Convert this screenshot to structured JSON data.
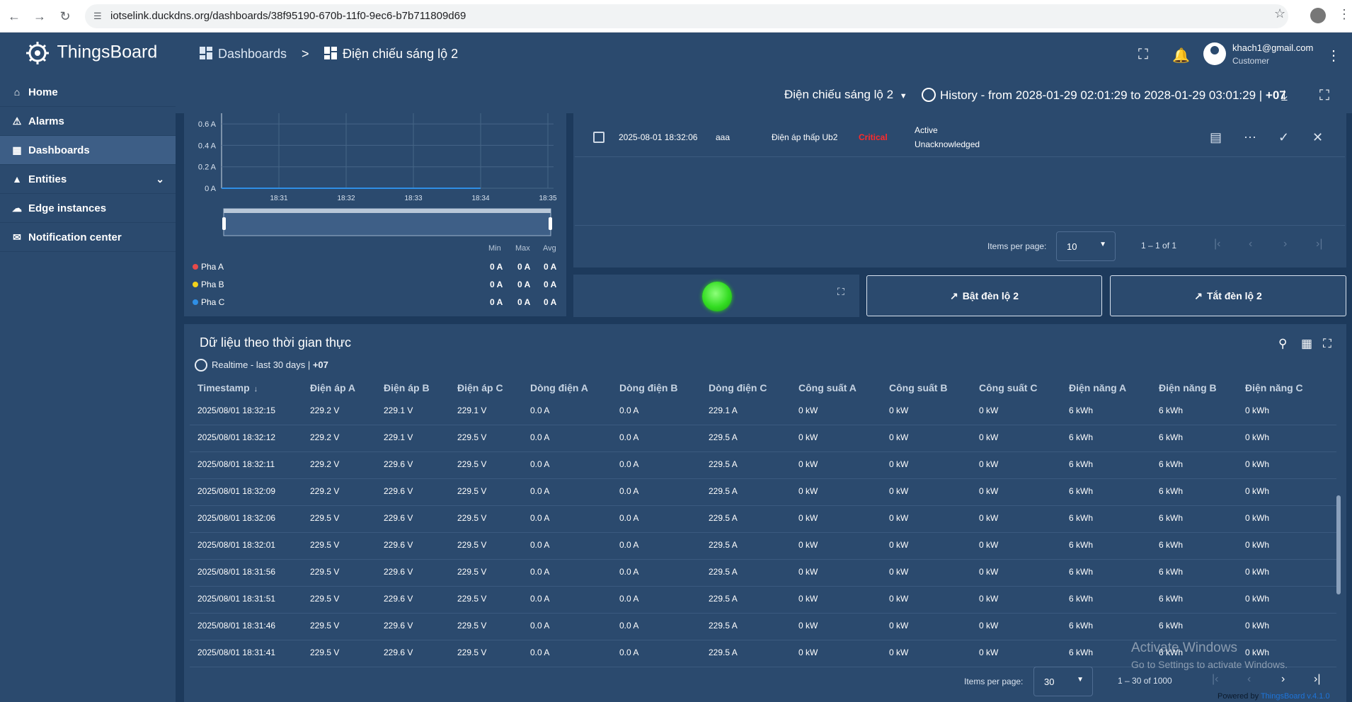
{
  "browser": {
    "url": "iotselink.duckdns.org/dashboards/38f95190-670b-11f0-9ec6-b7b711809d69",
    "back_icon": "arrow-left-icon",
    "forward_icon": "arrow-right-icon",
    "reload_icon": "reload-icon"
  },
  "app": {
    "name": "ThingsBoard"
  },
  "breadcrumb": {
    "root": "Dashboards",
    "separator": ">",
    "current": "Điện chiếu sáng lộ 2"
  },
  "user": {
    "email": "khach1@gmail.com",
    "role": "Customer"
  },
  "toolbar": {
    "state_selector": "Điện chiếu sáng lộ 2",
    "history_label": "History - from 2028-01-29 02:01:29 to 2028-01-29 03:01:29 | ",
    "history_tz": "+07"
  },
  "sidebar": {
    "items": [
      {
        "label": "Home",
        "icon": "home-icon"
      },
      {
        "label": "Alarms",
        "icon": "warning-icon"
      },
      {
        "label": "Dashboards",
        "icon": "dashboard-icon",
        "active": true
      },
      {
        "label": "Entities",
        "icon": "entities-icon",
        "expandable": true
      },
      {
        "label": "Edge instances",
        "icon": "edge-icon"
      },
      {
        "label": "Notification center",
        "icon": "notification-icon"
      }
    ]
  },
  "chart_data": {
    "type": "line",
    "title": "",
    "xlabel": "",
    "ylabel": "",
    "y_ticks": [
      "0.6 A",
      "0.4 A",
      "0.2 A",
      "0 A"
    ],
    "ylim": [
      0,
      0.7
    ],
    "x_ticks": [
      "18:31",
      "18:32",
      "18:33",
      "18:34",
      "18:35"
    ],
    "series": [
      {
        "name": "Pha A",
        "color": "#e84a4a",
        "values": [
          0,
          0,
          0,
          0,
          0
        ]
      },
      {
        "name": "Pha B",
        "color": "#f2d21b",
        "values": [
          0,
          0,
          0,
          0,
          0
        ]
      },
      {
        "name": "Pha C",
        "color": "#2f8fe6",
        "values": [
          0,
          0,
          0,
          0,
          0
        ]
      }
    ],
    "legend_headers": [
      "Min",
      "Max",
      "Avg"
    ],
    "legend_values": [
      [
        "0 A",
        "0 A",
        "0 A"
      ],
      [
        "0 A",
        "0 A",
        "0 A"
      ],
      [
        "0 A",
        "0 A",
        "0 A"
      ]
    ]
  },
  "alarm": {
    "time": "2025-08-01 18:32:06",
    "originator": "aaa",
    "type": "Điện áp thấp Ub2",
    "severity": "Critical",
    "status_line1": "Active",
    "status_line2": "Unacknowledged",
    "pager": {
      "items_label": "Items per page:",
      "items_value": "10",
      "range": "1 – 1 of 1"
    }
  },
  "controls": {
    "on_button": "Bật đèn lộ 2",
    "off_button": "Tắt đèn lộ 2",
    "indicator_color": "#33dd22"
  },
  "table": {
    "title": "Dữ liệu theo thời gian thực",
    "subtitle": "Realtime - last 30 days | ",
    "subtitle_tz": "+07",
    "columns": [
      "Timestamp",
      "Điện áp A",
      "Điện áp B",
      "Điện áp C",
      "Dòng điện A",
      "Dòng điện B",
      "Dòng điện C",
      "Công suất A",
      "Công suất B",
      "Công suất C",
      "Điện năng A",
      "Điện năng B",
      "Điện năng C"
    ],
    "sort_icon": "arrow-down-icon",
    "rows": [
      [
        "2025/08/01 18:32:15",
        "229.2 V",
        "229.1 V",
        "229.1 V",
        "0.0 A",
        "0.0 A",
        "229.1 A",
        "0 kW",
        "0 kW",
        "0 kW",
        "6 kWh",
        "6 kWh",
        "0 kWh"
      ],
      [
        "2025/08/01 18:32:12",
        "229.2 V",
        "229.1 V",
        "229.5 V",
        "0.0 A",
        "0.0 A",
        "229.5 A",
        "0 kW",
        "0 kW",
        "0 kW",
        "6 kWh",
        "6 kWh",
        "0 kWh"
      ],
      [
        "2025/08/01 18:32:11",
        "229.2 V",
        "229.6 V",
        "229.5 V",
        "0.0 A",
        "0.0 A",
        "229.5 A",
        "0 kW",
        "0 kW",
        "0 kW",
        "6 kWh",
        "6 kWh",
        "0 kWh"
      ],
      [
        "2025/08/01 18:32:09",
        "229.2 V",
        "229.6 V",
        "229.5 V",
        "0.0 A",
        "0.0 A",
        "229.5 A",
        "0 kW",
        "0 kW",
        "0 kW",
        "6 kWh",
        "6 kWh",
        "0 kWh"
      ],
      [
        "2025/08/01 18:32:06",
        "229.5 V",
        "229.6 V",
        "229.5 V",
        "0.0 A",
        "0.0 A",
        "229.5 A",
        "0 kW",
        "0 kW",
        "0 kW",
        "6 kWh",
        "6 kWh",
        "0 kWh"
      ],
      [
        "2025/08/01 18:32:01",
        "229.5 V",
        "229.6 V",
        "229.5 V",
        "0.0 A",
        "0.0 A",
        "229.5 A",
        "0 kW",
        "0 kW",
        "0 kW",
        "6 kWh",
        "6 kWh",
        "0 kWh"
      ],
      [
        "2025/08/01 18:31:56",
        "229.5 V",
        "229.6 V",
        "229.5 V",
        "0.0 A",
        "0.0 A",
        "229.5 A",
        "0 kW",
        "0 kW",
        "0 kW",
        "6 kWh",
        "6 kWh",
        "0 kWh"
      ],
      [
        "2025/08/01 18:31:51",
        "229.5 V",
        "229.6 V",
        "229.5 V",
        "0.0 A",
        "0.0 A",
        "229.5 A",
        "0 kW",
        "0 kW",
        "0 kW",
        "6 kWh",
        "6 kWh",
        "0 kWh"
      ],
      [
        "2025/08/01 18:31:46",
        "229.5 V",
        "229.6 V",
        "229.5 V",
        "0.0 A",
        "0.0 A",
        "229.5 A",
        "0 kW",
        "0 kW",
        "0 kW",
        "6 kWh",
        "6 kWh",
        "0 kWh"
      ],
      [
        "2025/08/01 18:31:41",
        "229.5 V",
        "229.6 V",
        "229.5 V",
        "0.0 A",
        "0.0 A",
        "229.5 A",
        "0 kW",
        "0 kW",
        "0 kW",
        "6 kWh",
        "6 kWh",
        "0 kWh"
      ]
    ],
    "pager": {
      "items_label": "Items per page:",
      "items_value": "30",
      "range": "1 – 30 of 1000"
    }
  },
  "overlay": {
    "activate_title": "Activate Windows",
    "activate_sub": "Go to Settings to activate Windows.",
    "powered_prefix": "Powered by ",
    "powered_link": "ThingsBoard v.4.1.0"
  }
}
